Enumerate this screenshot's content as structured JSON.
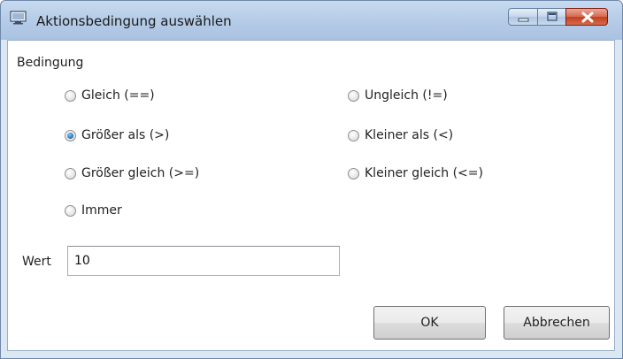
{
  "window": {
    "title": "Aktionsbedingung auswählen"
  },
  "condition_group": {
    "label": "Bedingung",
    "options": [
      {
        "label": "Gleich (==)",
        "checked": false
      },
      {
        "label": "Ungleich (!=)",
        "checked": false
      },
      {
        "label": "Größer als (>)",
        "checked": true
      },
      {
        "label": "Kleiner als (<)",
        "checked": false
      },
      {
        "label": "Größer gleich (>=)",
        "checked": false
      },
      {
        "label": "Kleiner gleich (<=)",
        "checked": false
      },
      {
        "label": "Immer",
        "checked": false
      }
    ]
  },
  "value_field": {
    "label": "Wert",
    "value": "10"
  },
  "buttons": {
    "ok": "OK",
    "cancel": "Abbrechen"
  },
  "colors": {
    "titlebar": "#b7cde8",
    "close_button": "#c2401f",
    "radio_selected": "#2a7fc9"
  }
}
